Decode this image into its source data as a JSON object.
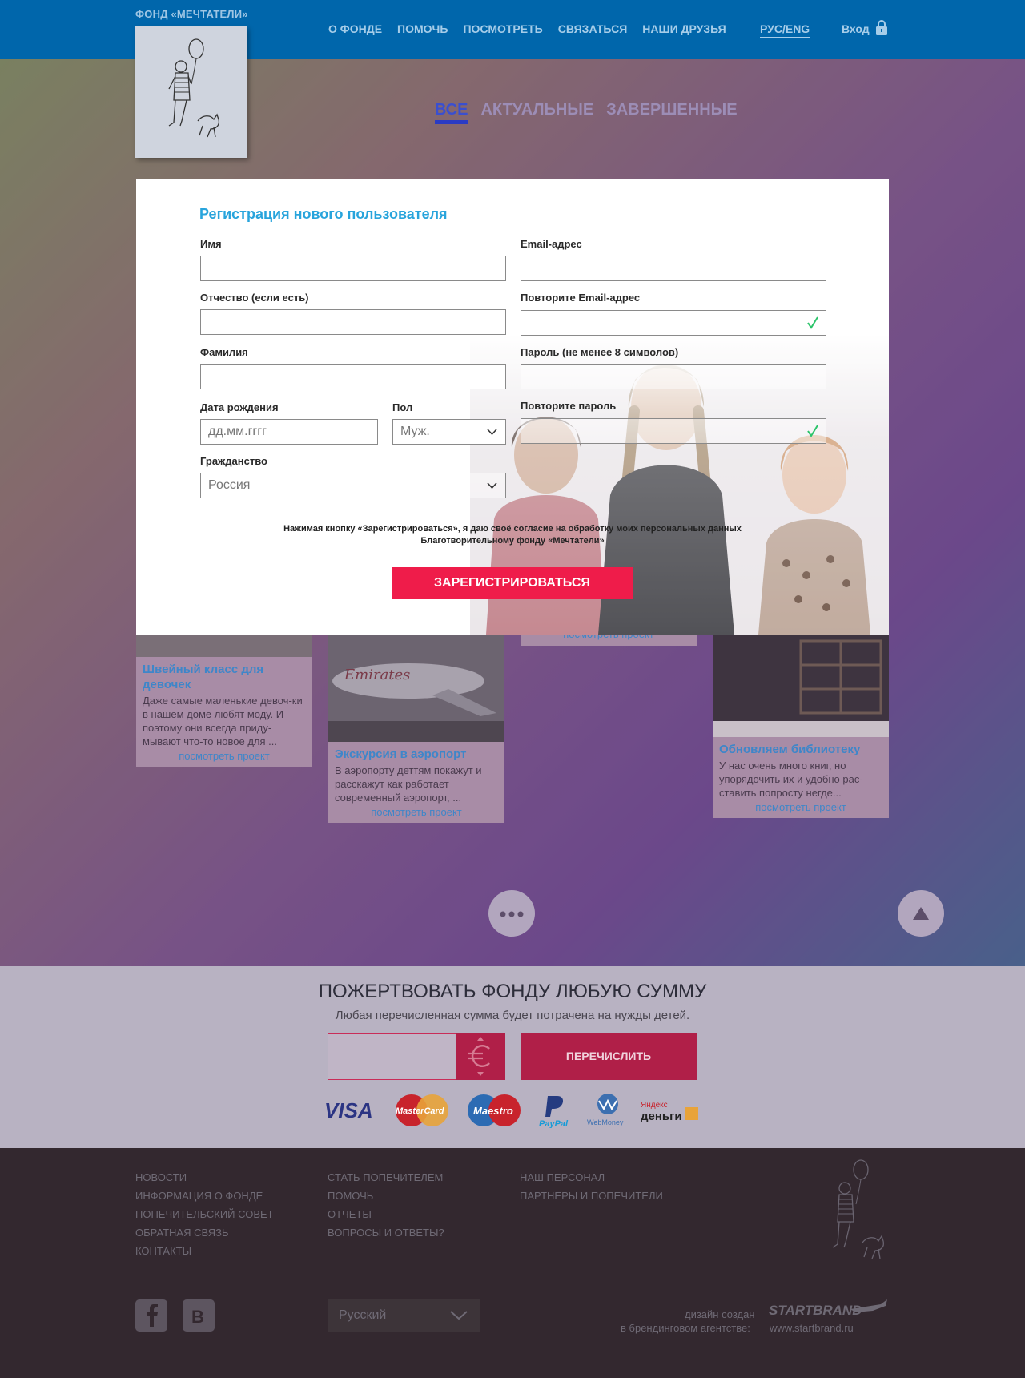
{
  "header": {
    "brand": "ФОНД «МЕЧТАТЕЛИ»",
    "nav": [
      "О ФОНДЕ",
      "ПОМОЧЬ",
      "ПОСМОТРЕТЬ",
      "СВЯЗАТЬСЯ",
      "НАШИ ДРУЗЬЯ"
    ],
    "lang": "РУС/ENG",
    "login": "Вход",
    "login_icon": "lock-icon"
  },
  "filters": {
    "all": "ВСЕ",
    "current": "АКТУАЛЬНЫЕ",
    "finished": "ЗАВЕРШЕННЫЕ",
    "active": "ВСЕ"
  },
  "projects": [
    {
      "title": "Швейный класс для девочек",
      "desc": "Даже самые маленькие девоч-ки в нашем доме любят моду. И поэтому они всегда приду-мывают что-то новое для ...",
      "link": "посмотреть проект"
    },
    {
      "title": "Экскурсия в аэропорт",
      "desc": "В аэропорту деттям покажут и расскажут как работает современный аэропорт, ...",
      "link": "посмотреть проект"
    },
    {
      "title": "",
      "desc": "",
      "link": "посмотреть проект"
    },
    {
      "title": "Обновляем библиотеку",
      "desc": "У нас очень много книг, но упорядочить их и удобно рас-ставить попросту негде...",
      "link": "посмотреть проект"
    }
  ],
  "modal": {
    "title": "Регистрация нового пользователя",
    "first_name_label": "Имя",
    "patronymic_label": "Отчество (если есть)",
    "last_name_label": "Фамилия",
    "birth_label": "Дата рождения",
    "birth_placeholder": "дд.мм.гггг",
    "gender_label": "Пол",
    "gender_value": "Муж.",
    "citizenship_label": "Гражданство",
    "citizenship_value": "Россия",
    "email_label": "Email-адрес",
    "email_repeat_label": "Повторите Email-адрес",
    "password_label": "Пароль (не менее 8 символов)",
    "password_repeat_label": "Повторите пароль",
    "consent_line1": "Нажимая кнопку «Зарегистрироваться», я даю своё согласие на обработку моих персональных данных",
    "consent_line2": "Благотворительному фонду «Мечтатели»",
    "submit": "ЗАРЕГИСТРИРОВАТЬСЯ"
  },
  "buttons": {
    "more_icon": "more-dots-icon",
    "up_icon": "arrow-up-icon"
  },
  "donate": {
    "title": "ПОЖЕРТВОВАТЬ ФОНДУ ЛЮБУЮ СУММУ",
    "subtitle": "Любая перечисленная сумма будет потрачена на нужды детей.",
    "amount_value": "",
    "currency_icon": "euro-icon",
    "submit": "ПЕРЕЧИСЛИТЬ",
    "payment_methods": [
      "VISA",
      "MasterCard",
      "Maestro",
      "PayPal",
      "WebMoney",
      "Яндекс деньги"
    ]
  },
  "footer": {
    "col1": [
      "НОВОСТИ",
      "ИНФОРМАЦИЯ О ФОНДЕ",
      "ПОПЕЧИТЕЛЬСКИЙ СОВЕТ",
      "ОБРАТНАЯ СВЯЗЬ",
      "КОНТАКТЫ"
    ],
    "col2": [
      "СТАТЬ ПОПЕЧИТЕЛЕМ",
      "ПОМОЧЬ",
      "ОТЧЕТЫ",
      "ВОПРОСЫ И ОТВЕТЫ?"
    ],
    "col3": [
      "НАШ ПЕРСОНАЛ",
      "ПАРТНЕРЫ И ПОПЕЧИТЕЛИ"
    ],
    "language": "Русский",
    "credit_line1": "дизайн создан",
    "credit_line2": "в брендинговом агентстве:",
    "agency": "STARTBRAND",
    "agency_url": "www.startbrand.ru"
  },
  "colors": {
    "header": "#0066ab",
    "modal_title": "#28a4dc",
    "accent": "#ef1c4a",
    "footer": "#33282f"
  }
}
